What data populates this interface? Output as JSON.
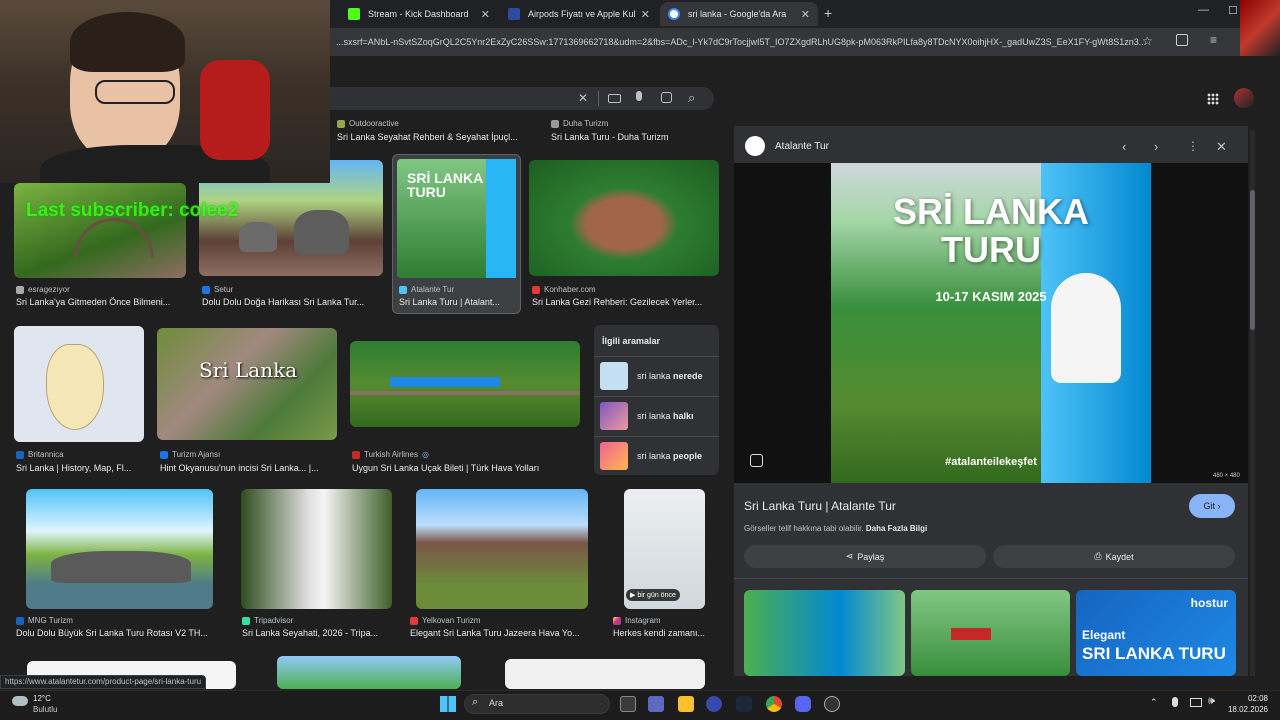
{
  "tabs": [
    {
      "title": "Stream - Kick Dashboard",
      "color": "#53fc18"
    },
    {
      "title": "Airpods Fiyatı ve Apple Kulaklık",
      "color": "#2d4ba0"
    },
    {
      "title": "sri lanka - Google'da Ara",
      "color": "#4285f4"
    }
  ],
  "address": "...sxsrf=ANbL-nSvtSZoqGrQL2C5Ynr2ExZyC26SSw:1771369662718&udm=2&fbs=ADc_l-Yk7dC9rTocjjwI5T_IO7ZXgdRLhUG8pk-pM063RkPILfa8y8TDcNYX0oihjHX-_gadUwZ3S_EeX1FY-gWt8S1zn3...",
  "overlay_text": "Last subscriber: colee2",
  "results": {
    "top_row": [
      {
        "source": "Outdooractive",
        "title": "Sri Lanka Seyahat Rehberi & Seyahat İpuçl..."
      },
      {
        "source": "Duha Turizm",
        "title": "Sri Lanka Turu - Duha Turizm"
      }
    ],
    "row1": [
      {
        "source": "esragezıyor",
        "title": "Sri Lanka'ya Gitmeden Önce Bilmeni..."
      },
      {
        "source": "Setur",
        "title": "Dolu Dolu Doğa Harikası Sri Lanka Tur..."
      },
      {
        "source": "Atalante Tur",
        "title": "Sri Lanka Turu | Atalant..."
      },
      {
        "source": "Konhaber.com",
        "title": "Sri Lanka Gezi Rehberi: Gezilecek Yerler..."
      }
    ],
    "row2": [
      {
        "source": "Britannica",
        "title": "Sri Lanka | History, Map, Fl..."
      },
      {
        "source": "Turizm Ajansı",
        "title": "Hint Okyanusu'nun incisi Sri Lanka... |..."
      },
      {
        "source": "Turkish Airlines",
        "title": "Uygun Sri Lanka Uçak Bileti | Türk Hava Yolları"
      }
    ],
    "row3": [
      {
        "source": "MNG Turizm",
        "title": "Dolu Dolu Büyük Sri Lanka Turu Rotası V2 TH..."
      },
      {
        "source": "Tripadvisor",
        "title": "Sri Lanka Seyahati, 2026 - Tripa..."
      },
      {
        "source": "Yelkovan Turizm",
        "title": "Elegant Sri Lanka Turu Jazeera Hava Yo..."
      },
      {
        "source": "Instagram",
        "title": "Herkes kendi zamanı..."
      }
    ],
    "thumb_overlay": "Sri Lanka",
    "video_badge": "bir gün önce"
  },
  "related": {
    "heading": "İlgili aramalar",
    "items": [
      {
        "prefix": "sri lanka",
        "bold": "nerede"
      },
      {
        "prefix": "sri lanka",
        "bold": "halkı"
      },
      {
        "prefix": "sri lanka",
        "bold": "people"
      }
    ]
  },
  "panel": {
    "source": "Atalante Tur",
    "img_title1": "SRİ LANKA",
    "img_title2": "TURU",
    "img_date": "10-17 KASIM 2025",
    "img_hashtag": "#atalanteilekeşfet",
    "img_size": "480 × 480",
    "title": "Sri Lanka Turu | Atalante Tur",
    "copyright": "Görseller telif hakkına tabi olabilir.",
    "more_info": "Daha Fazla Bilgi",
    "go": "Git",
    "share": "Paylaş",
    "save": "Kaydet",
    "related_badge": "Elegant",
    "related_text": "SRI LANKA TURU",
    "related_brand": "hostur"
  },
  "status_url": "https://www.atalantetur.com/product-page/sri-lanka-turu",
  "taskbar": {
    "temp": "12°C",
    "weather": "Bulutlu",
    "search": "Ara",
    "time": "02:08",
    "date": "18.02.2026"
  }
}
